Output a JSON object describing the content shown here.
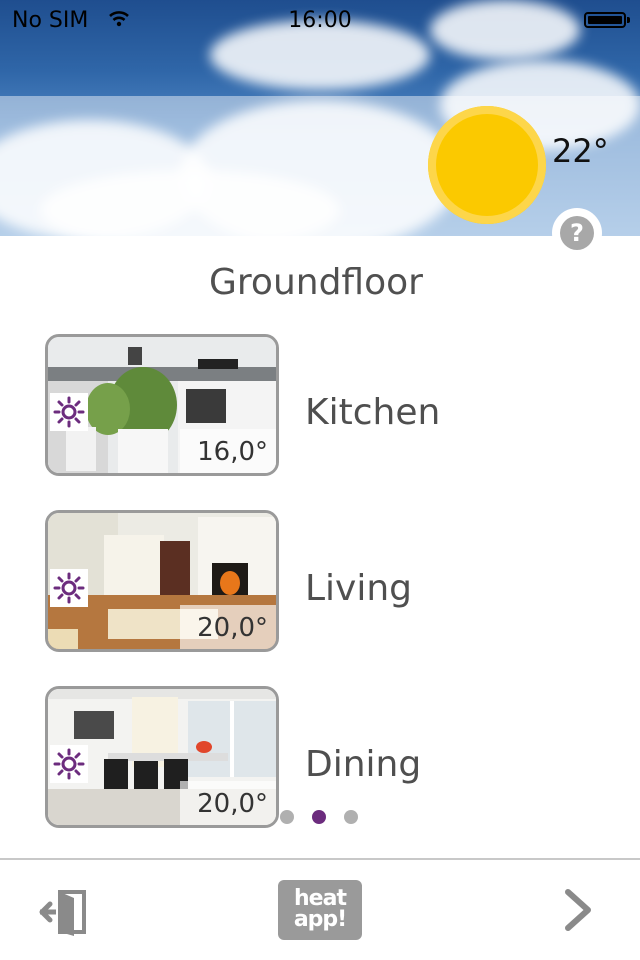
{
  "status_bar": {
    "carrier": "No SIM",
    "time": "16:00"
  },
  "weather": {
    "outdoor_temp": "22°",
    "icon": "sun-icon",
    "help_label": "?"
  },
  "floor": {
    "title": "Groundfloor"
  },
  "rooms": [
    {
      "name": "Kitchen",
      "temperature": "16,0°",
      "mode_icon": "sun-mode-icon"
    },
    {
      "name": "Living",
      "temperature": "20,0°",
      "mode_icon": "sun-mode-icon"
    },
    {
      "name": "Dining",
      "temperature": "20,0°",
      "mode_icon": "sun-mode-icon"
    }
  ],
  "pager": {
    "page_count": 3,
    "current_page": 2
  },
  "bottom_bar": {
    "logo_line1": "heat",
    "logo_line2": "app!",
    "exit_icon": "logout-icon",
    "next_icon": "chevron-right-icon"
  },
  "colors": {
    "accent": "#6c2c7e",
    "sun": "#fbc900",
    "text": "#4f4f4f"
  }
}
